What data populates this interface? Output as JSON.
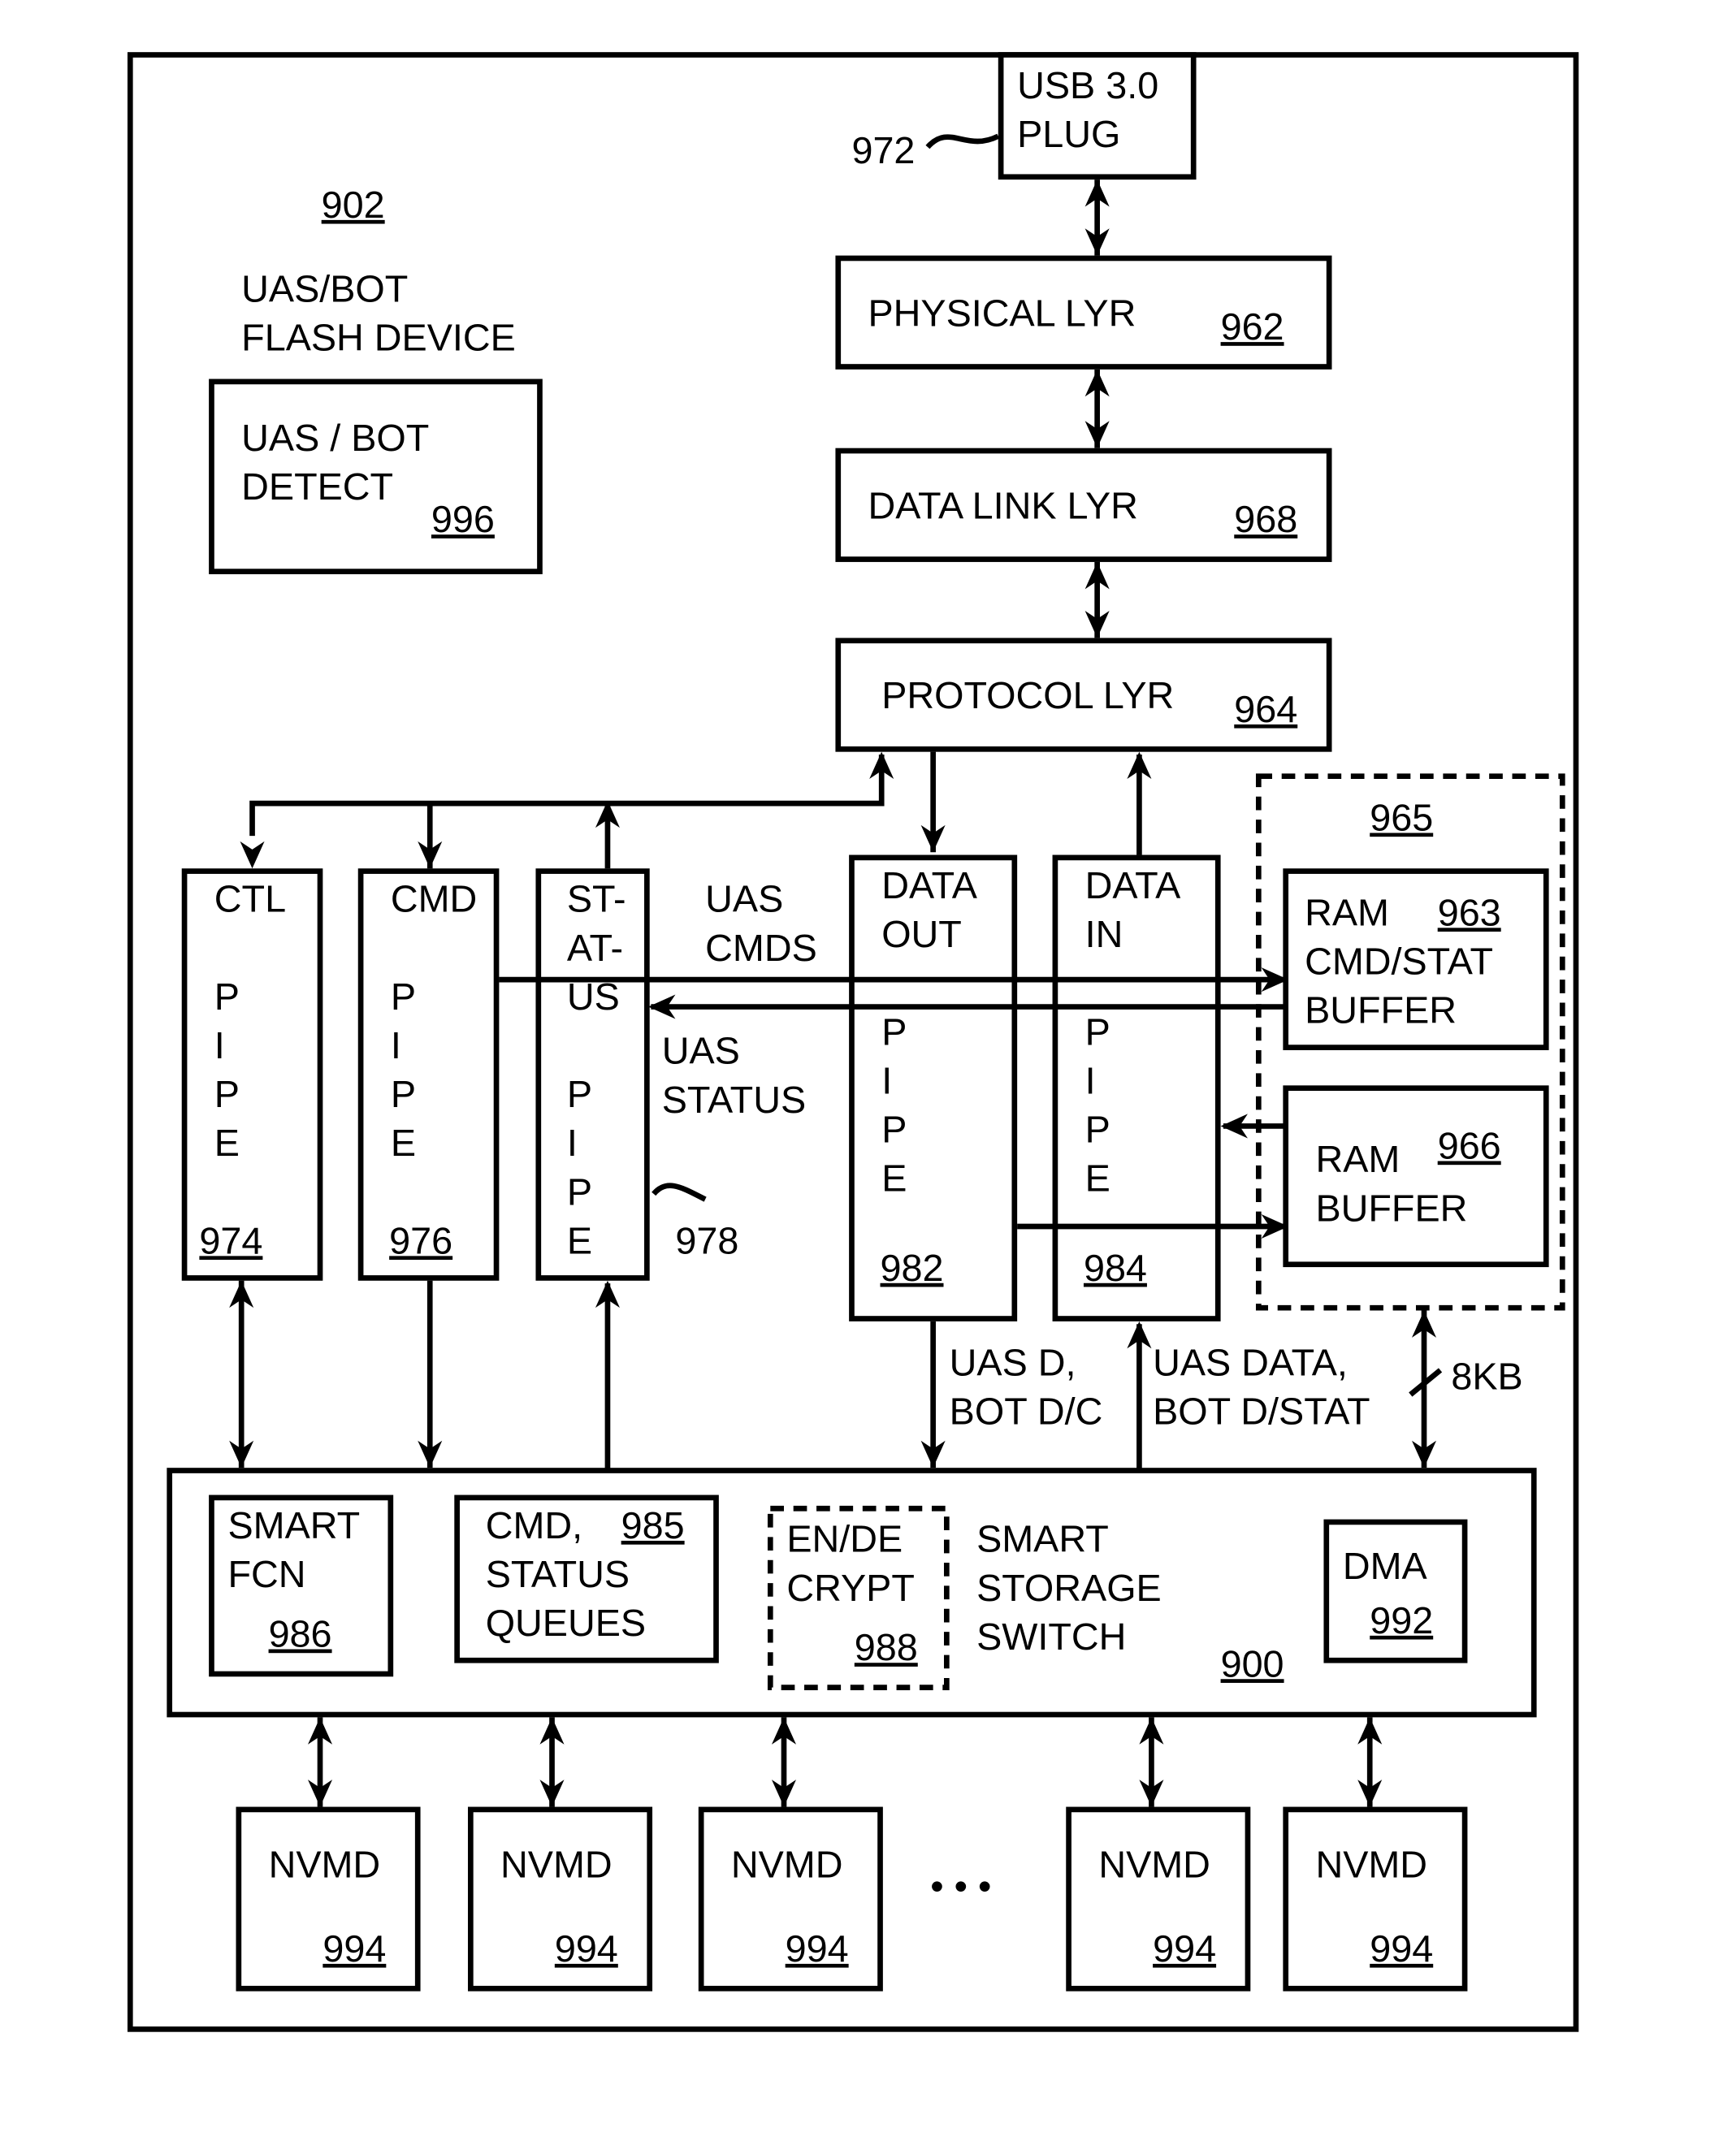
{
  "device": {
    "ref": "902",
    "title_lines": [
      "UAS/BOT",
      "FLASH DEVICE"
    ]
  },
  "blocks": {
    "usb": {
      "lines": [
        "USB 3.0",
        "PLUG"
      ],
      "ref": "972"
    },
    "phy": {
      "label": "PHYSICAL LYR",
      "ref": "962"
    },
    "dll": {
      "label": "DATA LINK LYR",
      "ref": "968"
    },
    "proto": {
      "label": "PROTOCOL LYR",
      "ref": "964"
    },
    "detect": {
      "lines": [
        "UAS / BOT",
        "DETECT"
      ],
      "ref": "996"
    },
    "ctl": {
      "lines": [
        "CTL",
        "",
        "P",
        "I",
        "P",
        "E"
      ],
      "ref": "974"
    },
    "cmd": {
      "lines": [
        "CMD",
        "",
        "P",
        "I",
        "P",
        "E"
      ],
      "ref": "976"
    },
    "status": {
      "lines": [
        "ST-",
        "AT-",
        "US",
        "",
        "P",
        "I",
        "P",
        "E"
      ],
      "ref": "978"
    },
    "dout": {
      "lines": [
        "DATA",
        "OUT",
        "",
        "P",
        "I",
        "P",
        "E"
      ],
      "ref": "982"
    },
    "din": {
      "lines": [
        "DATA",
        "IN",
        "",
        "P",
        "I",
        "P",
        "E"
      ],
      "ref": "984"
    },
    "ramgroup": {
      "ref": "965"
    },
    "ramcmd": {
      "lines": [
        "RAM",
        "CMD/STAT",
        "BUFFER"
      ],
      "ref": "963"
    },
    "rambuf": {
      "lines": [
        "RAM",
        "BUFFER"
      ],
      "ref": "966"
    },
    "switch": {
      "lines": [
        "SMART",
        "STORAGE",
        "SWITCH"
      ],
      "ref": "900"
    },
    "smartfcn": {
      "lines": [
        "SMART",
        "FCN"
      ],
      "ref": "986"
    },
    "queues": {
      "lines": [
        "CMD,",
        "STATUS",
        "QUEUES"
      ],
      "ref": "985"
    },
    "crypt": {
      "lines": [
        "EN/DE",
        "CRYPT"
      ],
      "ref": "988"
    },
    "dma": {
      "label": "DMA",
      "ref": "992"
    },
    "nvmd": {
      "label": "NVMD",
      "ref": "994",
      "ellipsis": "• • •"
    }
  },
  "signals": {
    "uas_cmds": [
      "UAS",
      "CMDS"
    ],
    "uas_status": [
      "UAS",
      "STATUS"
    ],
    "uas_d": [
      "UAS D,",
      "BOT D/C"
    ],
    "uas_data": [
      "UAS DATA,",
      "BOT D/STAT"
    ],
    "bus_width": "8KB"
  }
}
